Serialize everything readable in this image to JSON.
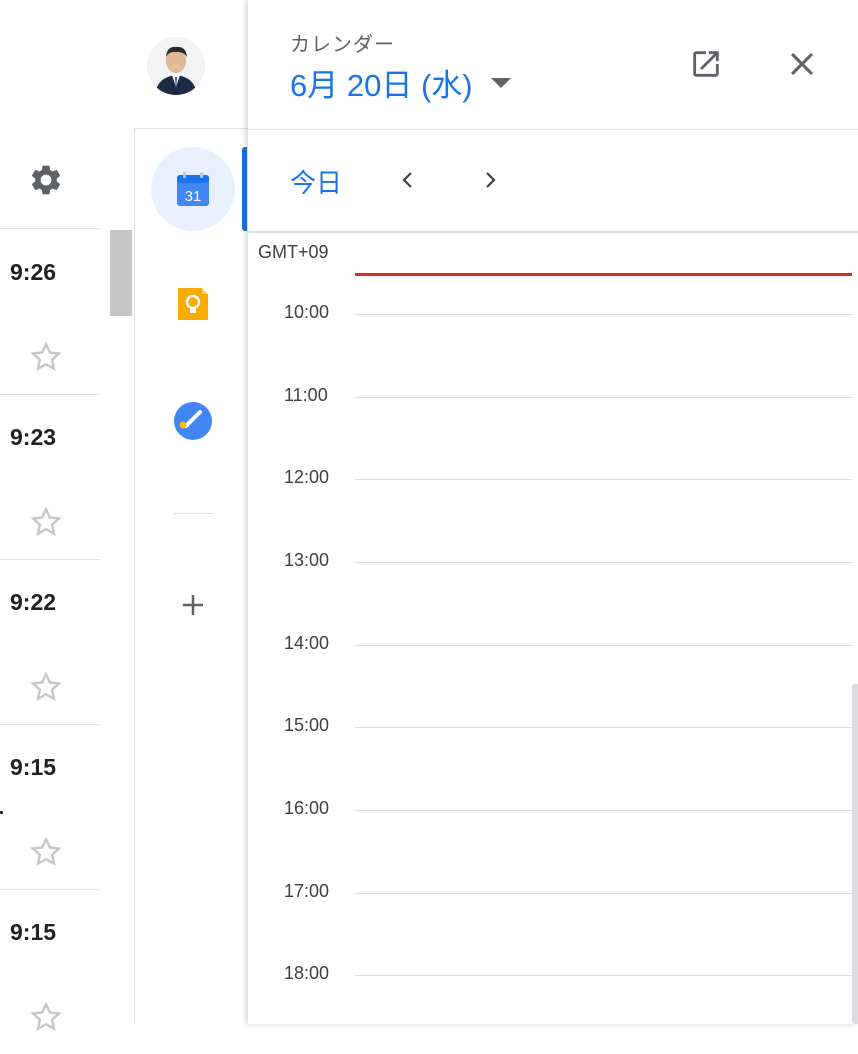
{
  "gmail": {
    "rows": [
      {
        "time": "9:26"
      },
      {
        "time": "9:23"
      },
      {
        "time": "9:22"
      },
      {
        "time": "9:15"
      },
      {
        "time": "9:15"
      }
    ]
  },
  "calendar": {
    "app_name": "カレンダー",
    "date": "6月 20日 (水)",
    "today_label": "今日",
    "timezone": "GMT+09",
    "hours": [
      "10:00",
      "11:00",
      "12:00",
      "13:00",
      "14:00",
      "15:00",
      "16:00",
      "17:00",
      "18:00"
    ]
  },
  "rail": {
    "calendar_day": "31"
  },
  "colors": {
    "accent": "#1a73e8",
    "now_line": "#d93025",
    "keep_yellow": "#f9ab00",
    "tasks_blue": "#4285f4"
  },
  "icons": [
    "bell-icon",
    "avatar",
    "gear-icon",
    "star-icon",
    "calendar-icon",
    "keep-icon",
    "tasks-icon",
    "plus-icon",
    "open-in-new-icon",
    "close-icon",
    "chevron-left-icon",
    "chevron-right-icon",
    "caret-down-icon"
  ]
}
